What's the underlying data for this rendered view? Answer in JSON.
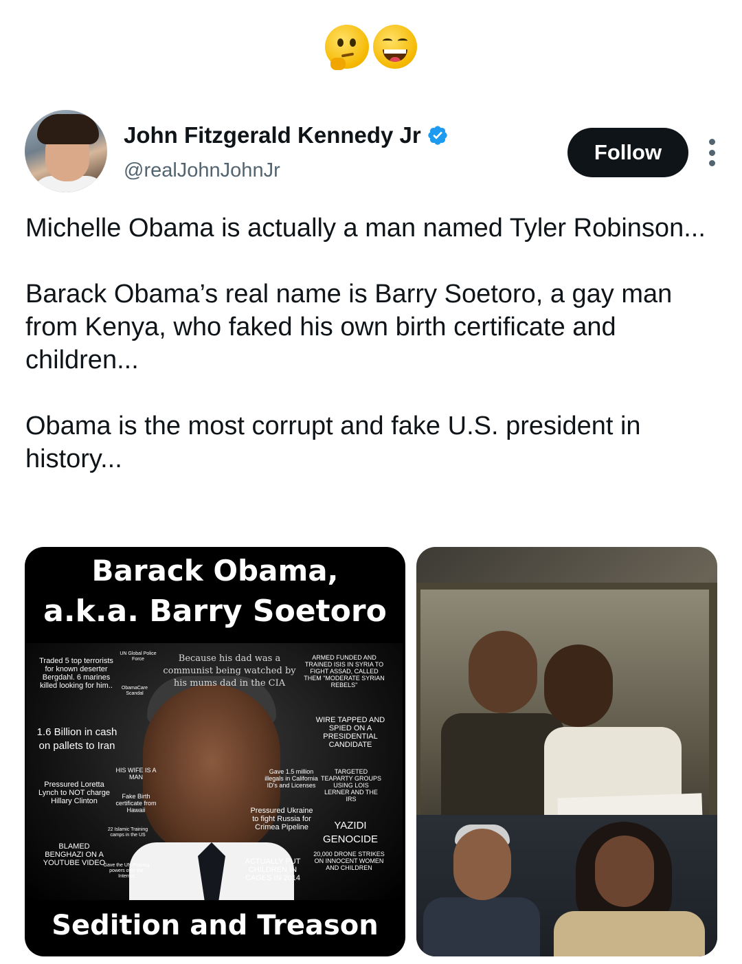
{
  "top_reaction": {
    "emojis": [
      "thinking-face",
      "grinning-squinting-face"
    ]
  },
  "author": {
    "name": "John Fitzgerald Kennedy Jr",
    "handle": "@realJohnJohnJr",
    "verified": true,
    "follow_label": "Follow"
  },
  "tweet": {
    "paragraphs": [
      "Michelle Obama is actually a man named Tyler Robinson...",
      "Barack Obama’s real name is Barry Soetoro, a gay man from Kenya, who faked his own birth certificate and children...",
      "Obama is the most corrupt and fake U.S. president in history..."
    ]
  },
  "media": {
    "left": {
      "title_line1": "Barack Obama,",
      "title_line2": "a.k.a. Barry Soetoro",
      "footer": "Sedition and Treason",
      "captions": {
        "traded": "Traded 5 top terrorists for known deserter Bergdahl. 6 marines killed looking for him..",
        "un_global": "UN Global Police Force",
        "obamacare": "ObamaCare Scandal",
        "because": "Because his dad was a communist being watched by his mums dad in the CIA",
        "armed": "ARMED FUNDED AND TRAINED ISIS IN SYRIA TO FIGHT ASSAD, CALLED THEM \"MODERATE SYRIAN REBELS\"",
        "billion": "1.6 Billion in cash on pallets to Iran",
        "wire": "WIRE TAPPED AND SPIED ON A PRESIDENTIAL CANDIDATE",
        "wife": "HIS WIFE IS A MAN",
        "pressured_lynch": "Pressured Loretta Lynch to NOT charge Hillary Clinton",
        "fake_birth": "Fake Birth certificate from Hawaii",
        "gave_illegals": "Gave 1.5 million illegals in California ID's and Licenses",
        "targeted": "TARGETED TEAPARTY GROUPS USING LOIS LERNER AND THE IRS",
        "islamic": "22 Islamic Training camps in the US",
        "pressured_ukraine": "Pressured Ukraine to fight Russia for Crimea Pipeline",
        "yazidi": "YAZIDI GENOCIDE",
        "benghazi": "BLAMED BENGHAZI ON A YOUTUBE VIDEO",
        "un_policing": "Gave the UN Policing powers over the Internet",
        "cages": "ACTUALLY PUT CHILDREN IN CAGES IN 2014",
        "drone": "20,000 DRONE STRIKES ON INNOCENT WOMEN AND CHILDREN"
      }
    }
  }
}
